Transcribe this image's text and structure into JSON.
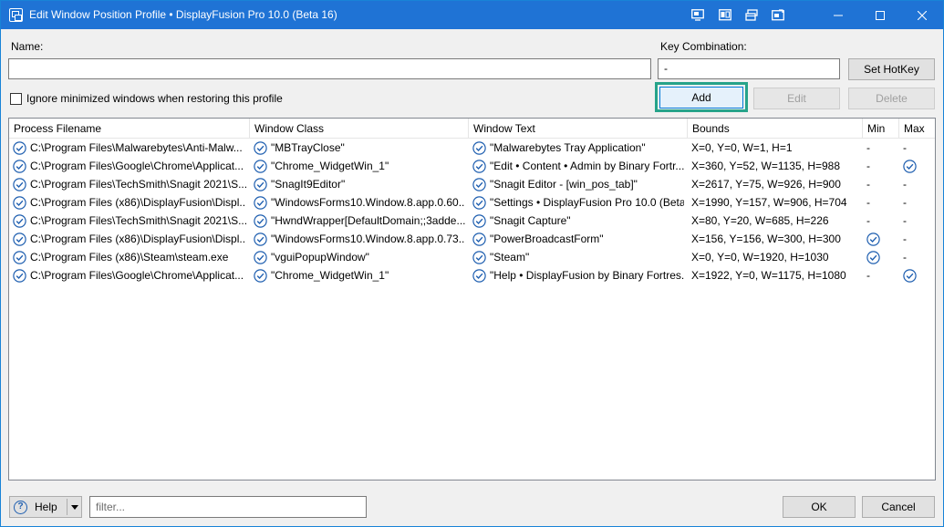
{
  "window": {
    "title": "Edit Window Position Profile • DisplayFusion Pro 10.0 (Beta 16)"
  },
  "colors": {
    "titlebar": "#1f73d5",
    "accent": "#0078d7",
    "highlight": "#26a38a",
    "check_icon": "#1f5fb0"
  },
  "titlebar_tools": [
    {
      "icon": "window-monitor-icon"
    },
    {
      "icon": "window-split-icon"
    },
    {
      "icon": "window-stack-icon"
    },
    {
      "icon": "window-size-icon"
    }
  ],
  "form": {
    "name_label": "Name:",
    "name_value": "",
    "key_combination_label": "Key Combination:",
    "key_combination_value": "-",
    "set_hotkey_label": "Set HotKey",
    "ignore_minimized_label": "Ignore minimized windows when restoring this profile",
    "ignore_minimized_checked": false,
    "add_label": "Add",
    "edit_label": "Edit",
    "delete_label": "Delete"
  },
  "table": {
    "columns": [
      "Process Filename",
      "Window Class",
      "Window Text",
      "Bounds",
      "Min",
      "Max"
    ],
    "rows": [
      {
        "process": "C:\\Program Files\\Malwarebytes\\Anti-Malw...",
        "window_class": "\"MBTrayClose\"",
        "window_text": "\"Malwarebytes Tray Application\"",
        "bounds": "X=0, Y=0, W=1, H=1",
        "min": "-",
        "max": "-",
        "min_checked": false,
        "max_checked": false
      },
      {
        "process": "C:\\Program Files\\Google\\Chrome\\Applicat...",
        "window_class": "\"Chrome_WidgetWin_1\"",
        "window_text": "\"Edit • Content • Admin by Binary Fortr...",
        "bounds": "X=360, Y=52, W=1135, H=988",
        "min": "-",
        "max": "",
        "min_checked": false,
        "max_checked": true
      },
      {
        "process": "C:\\Program Files\\TechSmith\\Snagit 2021\\S...",
        "window_class": "\"SnagIt9Editor\"",
        "window_text": "\"Snagit Editor - [win_pos_tab]\"",
        "bounds": "X=2617, Y=75, W=926, H=900",
        "min": "-",
        "max": "-",
        "min_checked": false,
        "max_checked": false
      },
      {
        "process": "C:\\Program Files (x86)\\DisplayFusion\\Displ...",
        "window_class": "\"WindowsForms10.Window.8.app.0.60...",
        "window_text": "\"Settings • DisplayFusion Pro 10.0 (Beta...",
        "bounds": "X=1990, Y=157, W=906, H=704",
        "min": "-",
        "max": "-",
        "min_checked": false,
        "max_checked": false
      },
      {
        "process": "C:\\Program Files\\TechSmith\\Snagit 2021\\S...",
        "window_class": "\"HwndWrapper[DefaultDomain;;3adde...",
        "window_text": "\"Snagit Capture\"",
        "bounds": "X=80, Y=20, W=685, H=226",
        "min": "-",
        "max": "-",
        "min_checked": false,
        "max_checked": false
      },
      {
        "process": "C:\\Program Files (x86)\\DisplayFusion\\Displ...",
        "window_class": "\"WindowsForms10.Window.8.app.0.73...",
        "window_text": "\"PowerBroadcastForm\"",
        "bounds": "X=156, Y=156, W=300, H=300",
        "min": "",
        "max": "-",
        "min_checked": true,
        "max_checked": false
      },
      {
        "process": "C:\\Program Files (x86)\\Steam\\steam.exe",
        "window_class": "\"vguiPopupWindow\"",
        "window_text": "\"Steam\"",
        "bounds": "X=0, Y=0, W=1920, H=1030",
        "min": "",
        "max": "-",
        "min_checked": true,
        "max_checked": false
      },
      {
        "process": "C:\\Program Files\\Google\\Chrome\\Applicat...",
        "window_class": "\"Chrome_WidgetWin_1\"",
        "window_text": "\"Help • DisplayFusion by Binary Fortres...",
        "bounds": "X=1922, Y=0, W=1175, H=1080",
        "min": "-",
        "max": "",
        "min_checked": false,
        "max_checked": true
      }
    ]
  },
  "footer": {
    "help_label": "Help",
    "filter_placeholder": "filter...",
    "ok_label": "OK",
    "cancel_label": "Cancel"
  }
}
